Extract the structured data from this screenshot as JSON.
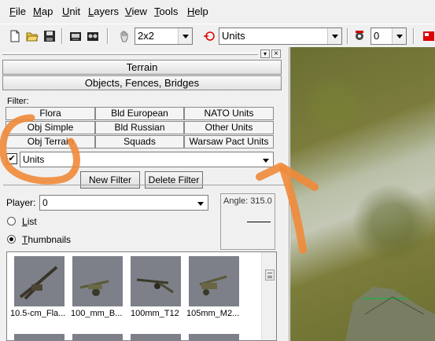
{
  "menu": [
    "File",
    "Map",
    "Unit",
    "Layers",
    "View",
    "Tools",
    "Help"
  ],
  "menu_underline": [
    "F",
    "M",
    "U",
    "L",
    "V",
    "T",
    "H"
  ],
  "toolbar": {
    "brush_size": "2x2",
    "layer": "Units",
    "number": "0"
  },
  "panel": {
    "tab_terrain": "Terrain",
    "tab_objects": "Objects, Fences, Bridges",
    "filter_label": "Filter:",
    "filters": [
      [
        "Flora",
        "Bld European",
        "NATO Units"
      ],
      [
        "Obj Simple",
        "Bld Russian",
        "Other Units"
      ],
      [
        "Obj Terrain",
        "Squads",
        "Warsaw Pact Units"
      ]
    ],
    "filter_value": "Units",
    "new_filter": "New Filter",
    "delete_filter": "Delete Filter",
    "player_label": "Player:",
    "player_value": "0",
    "angle_label": "Angle: 315.0",
    "view_list": "List",
    "view_thumbnails": "Thumbnails",
    "thumbnails": [
      "10.5-cm_Fla...",
      "100_mm_B...",
      "100mm_T12",
      "105mm_M2..."
    ]
  },
  "colors": {
    "annotation": "#f08a3a"
  }
}
